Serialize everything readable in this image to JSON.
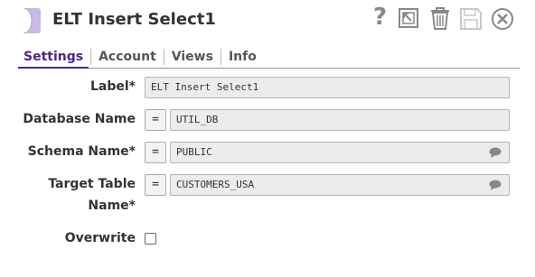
{
  "dialog": {
    "title": "ELT Insert Select1",
    "accent_color": "#4b2785",
    "snap_icon_color": "#c9b8e8"
  },
  "toolbar": {
    "help_label": "?",
    "icons": [
      "help-icon",
      "export-icon",
      "trash-icon",
      "save-icon",
      "close-icon"
    ]
  },
  "tabs": [
    {
      "label": "Settings",
      "active": true
    },
    {
      "label": "Account",
      "active": false
    },
    {
      "label": "Views",
      "active": false
    },
    {
      "label": "Info",
      "active": false
    }
  ],
  "form": {
    "label_field": {
      "label": "Label*",
      "value": "ELT Insert Select1"
    },
    "database_name": {
      "label": "Database Name",
      "expr_toggle": "=",
      "value": "UTIL_DB"
    },
    "schema_name": {
      "label": "Schema Name*",
      "expr_toggle": "=",
      "value": "PUBLIC"
    },
    "target_table_name": {
      "label": "Target Table Name*",
      "expr_toggle": "=",
      "value": "CUSTOMERS_USA"
    },
    "overwrite": {
      "label": "Overwrite",
      "checked": false
    }
  }
}
